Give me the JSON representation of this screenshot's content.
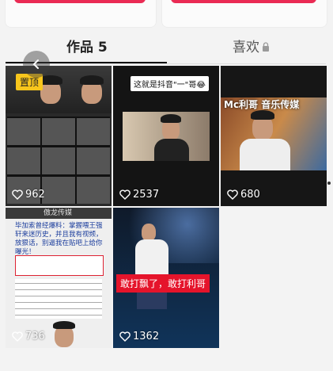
{
  "tabs": {
    "works_label": "作品 5",
    "likes_label": "喜欢"
  },
  "videos": [
    {
      "likes": "962",
      "pinned_label": "置顶"
    },
    {
      "likes": "2537",
      "caption": "这就是抖音\"一\"哥😂"
    },
    {
      "likes": "680",
      "banner": "Mc利哥 音乐传媒"
    },
    {
      "likes": "736",
      "header": "傲龙传媒",
      "text": "毕加索曾经爆料：掌握喂王强轩来迷历史，并且我有视频，放狠话，别逼我在贴吧上给你曝光！"
    },
    {
      "likes": "1362",
      "caption": "敢打飘了，敢打利哥"
    }
  ],
  "colors": {
    "accent": "#ea2b54",
    "pin": "#f8c61c"
  }
}
